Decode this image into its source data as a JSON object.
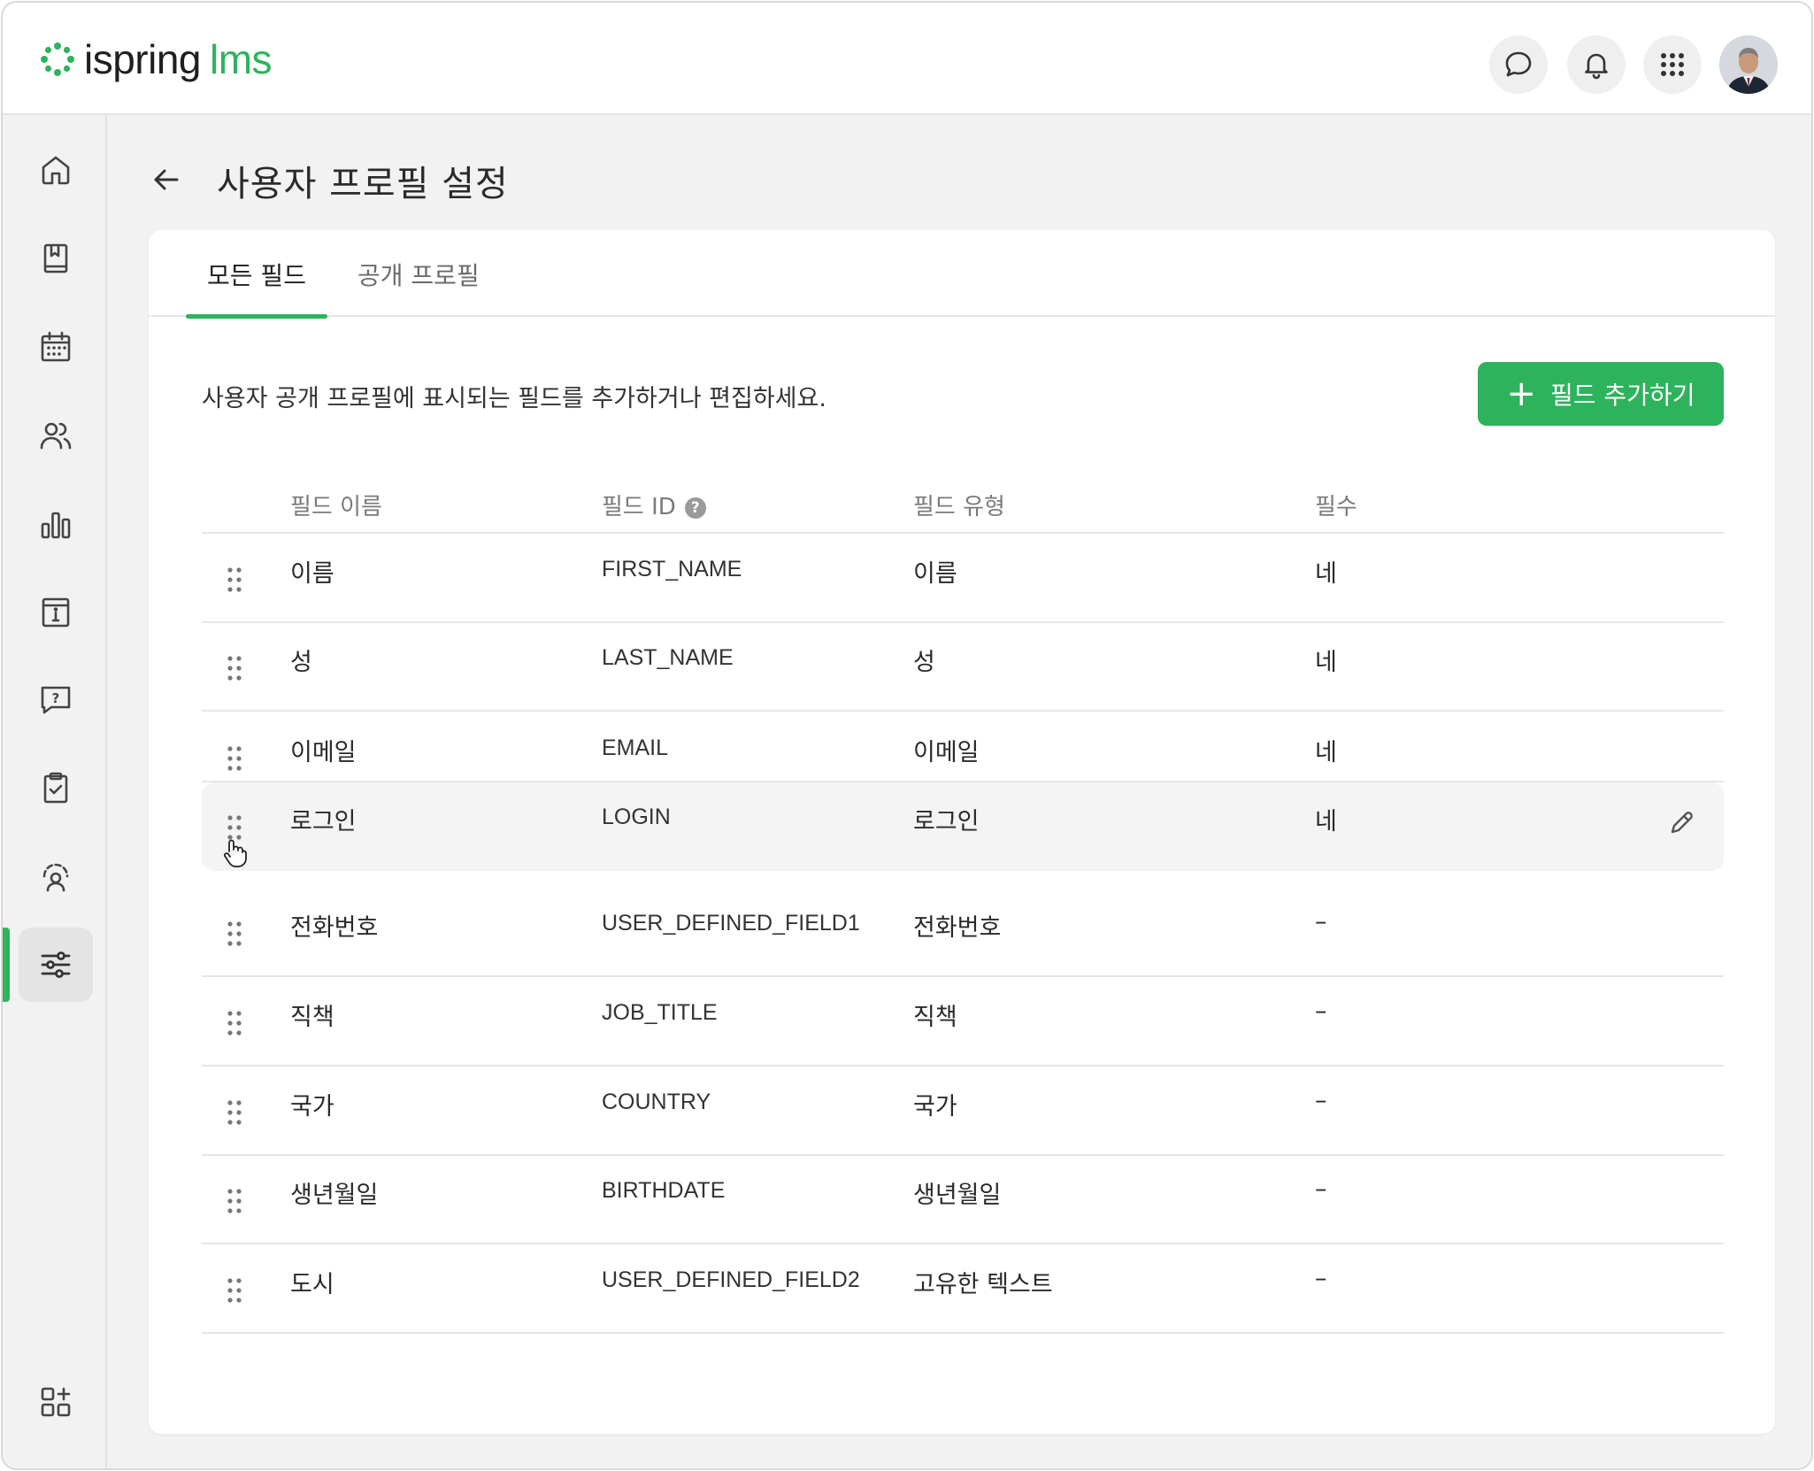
{
  "header": {
    "logo_word": "ispring",
    "logo_suffix": "lms",
    "brand_color": "#2db35c",
    "buttons": [
      "chat-icon",
      "bell-icon",
      "apps-grid-icon"
    ]
  },
  "sidebar": {
    "items": [
      "home-icon",
      "book-icon",
      "calendar-icon",
      "users-icon",
      "chart-icon",
      "info-icon",
      "help-chat-icon",
      "clipboard-check-icon",
      "user-support-icon",
      "settings-sliders-icon"
    ],
    "active_index": 9,
    "bottom": "add-widgets-icon"
  },
  "page": {
    "title": "사용자 프로필 설정",
    "tabs": [
      "모든 필드",
      "공개 프로필"
    ],
    "active_tab": 0,
    "description": "사용자 공개 프로필에 표시되는 필드를 추가하거나 편집하세요.",
    "add_button": "필드 추가하기"
  },
  "table": {
    "headers": [
      "필드 이름",
      "필드 ID",
      "필드 유형",
      "필수"
    ],
    "rows": [
      {
        "name": "이름",
        "id": "FIRST_NAME",
        "type": "이름",
        "required": "네"
      },
      {
        "name": "성",
        "id": "LAST_NAME",
        "type": "성",
        "required": "네"
      },
      {
        "name": "이메일",
        "id": "EMAIL",
        "type": "이메일",
        "required": "네"
      },
      {
        "name": "로그인",
        "id": "LOGIN",
        "type": "로그인",
        "required": "네"
      },
      {
        "name": "전화번호",
        "id": "USER_DEFINED_FIELD1",
        "type": "전화번호",
        "required": "–"
      },
      {
        "name": "직책",
        "id": "JOB_TITLE",
        "type": "직책",
        "required": "–"
      },
      {
        "name": "국가",
        "id": "COUNTRY",
        "type": "국가",
        "required": "–"
      },
      {
        "name": "생년월일",
        "id": "BIRTHDATE",
        "type": "생년월일",
        "required": "–"
      },
      {
        "name": "도시",
        "id": "USER_DEFINED_FIELD2",
        "type": "고유한 텍스트",
        "required": "–"
      }
    ],
    "hovered_row": 3
  }
}
